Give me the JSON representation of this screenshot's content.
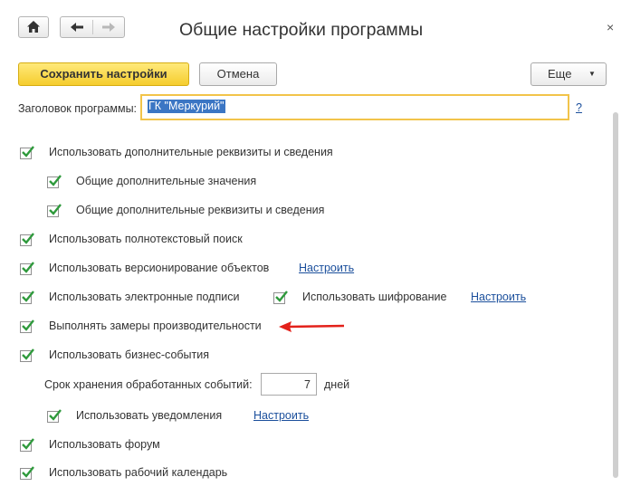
{
  "window": {
    "title": "Общие настройки программы",
    "close_glyph": "×",
    "home_icon": "home-icon",
    "back_icon": "arrow-left-icon",
    "forward_icon": "arrow-right-icon"
  },
  "toolbar": {
    "save_label": "Сохранить настройки",
    "cancel_label": "Отмена",
    "more_label": "Еще",
    "more_arrow": "▼"
  },
  "header_field": {
    "label": "Заголовок программы:",
    "value": "ГК \"Меркурий\"",
    "help": "?"
  },
  "options": {
    "additional_attrs": "Использовать дополнительные реквизиты и сведения",
    "common_values": "Общие дополнительные значения",
    "common_attrs": "Общие дополнительные реквизиты и сведения",
    "fulltext": "Использовать полнотекстовый поиск",
    "versioning": "Использовать версионирование объектов",
    "versioning_link": "Настроить",
    "signatures": "Использовать электронные подписи",
    "encryption": "Использовать шифрование",
    "encryption_link": "Настроить",
    "performance": "Выполнять замеры производительности",
    "business_events": "Использовать бизнес-события",
    "retention_label": "Срок хранения обработанных событий:",
    "retention_value": "7",
    "retention_unit": "дней",
    "notifications": "Использовать уведомления",
    "notifications_link": "Настроить",
    "forum": "Использовать форум",
    "work_calendar": "Использовать рабочий календарь"
  },
  "colors": {
    "check": "#2f9a3c",
    "annotation_arrow": "#e3211a",
    "link": "#1b4f9c",
    "primary_button": "#f5cd2e"
  }
}
